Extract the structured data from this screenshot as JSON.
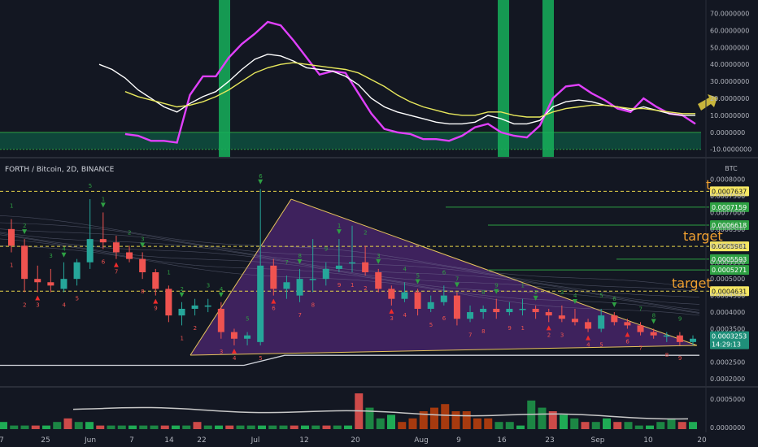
{
  "chart": {
    "title": "FORTH / Bitcoin, 2D, BINANCE",
    "unit": "BTC",
    "countdown": "14:29:13",
    "target_label": "target",
    "partial_target_label": "t"
  },
  "colors": {
    "background": "#131722",
    "bull": "#26a69a",
    "bear": "#ef5350",
    "triangle_fill": "#5b2a86",
    "triangle_line": "#e6c35c",
    "oscillator_fast": "#e040fb",
    "oscillator_mid": "#ffffff",
    "oscillator_slow": "#e8e85c",
    "oscillator_band": "#0b6e4f",
    "signal_bar": "#16b05a",
    "arrow": "#c8b53c",
    "dashed_target": "#e6d44a",
    "target_text": "#f0a030",
    "level_line": "#2ea043"
  },
  "chart_data": [
    {
      "type": "line",
      "name": "oscillator",
      "y_ticks": [
        "70.0000000",
        "60.0000000",
        "50.0000000",
        "40.0000000",
        "30.0000000",
        "20.0000000",
        "10.0000000",
        "0.0000000",
        "-10.0000000"
      ],
      "ylim": [
        -13,
        76
      ],
      "band": [
        -10,
        0
      ],
      "series": [
        {
          "role": "fast",
          "values": [
            5,
            -1,
            -1,
            -2,
            -5,
            -5,
            -6,
            22,
            33,
            33,
            44,
            52,
            58,
            65,
            63,
            54,
            44,
            34,
            36,
            35,
            23,
            11,
            2,
            0,
            -1,
            -4,
            -4,
            -5,
            -2,
            3,
            5,
            0,
            -2,
            -3,
            4,
            20,
            27,
            28,
            23,
            19,
            14,
            12,
            20,
            15,
            11,
            10,
            5
          ]
        },
        {
          "role": "mid",
          "values": [
            40,
            37,
            32,
            25,
            20,
            15,
            12,
            17,
            21,
            24,
            30,
            37,
            43,
            46,
            45,
            42,
            38,
            37,
            36,
            33,
            28,
            20,
            15,
            12,
            10,
            8,
            6,
            5,
            5,
            6,
            10,
            8,
            5,
            5,
            7,
            15,
            18,
            19,
            18,
            16,
            15,
            13,
            15,
            13,
            11,
            10,
            10
          ]
        },
        {
          "role": "slow",
          "values": [
            30,
            27,
            24,
            21,
            19,
            17,
            15,
            16,
            18,
            21,
            25,
            30,
            35,
            38,
            40,
            41,
            40,
            39,
            38,
            37,
            35,
            31,
            27,
            22,
            18,
            15,
            13,
            11,
            10,
            10,
            12,
            12,
            10,
            9,
            9,
            12,
            14,
            15,
            16,
            16,
            15,
            14,
            14,
            13,
            12,
            11,
            11
          ]
        }
      ],
      "signal_bars": [
        "Jun 24",
        "Aug 14",
        "Aug 23"
      ],
      "annotation": "arrow"
    },
    {
      "type": "bar",
      "name": "FORTH / Bitcoin, 2D, BINANCE",
      "candles": [
        {
          "o": 0.00065,
          "h": 0.00068,
          "l": 0.00058,
          "c": 0.0006
        },
        {
          "o": 0.0006,
          "h": 0.00062,
          "l": 0.00046,
          "c": 0.0005
        },
        {
          "o": 0.0005,
          "h": 0.00054,
          "l": 0.00046,
          "c": 0.00049
        },
        {
          "o": 0.00049,
          "h": 0.00053,
          "l": 0.00046,
          "c": 0.00048
        },
        {
          "o": 0.00047,
          "h": 0.00055,
          "l": 0.00046,
          "c": 0.0005
        },
        {
          "o": 0.0005,
          "h": 0.00056,
          "l": 0.00048,
          "c": 0.00055
        },
        {
          "o": 0.00055,
          "h": 0.00074,
          "l": 0.00053,
          "c": 0.00062
        },
        {
          "o": 0.00062,
          "h": 0.0007,
          "l": 0.00059,
          "c": 0.00061
        },
        {
          "o": 0.00061,
          "h": 0.00063,
          "l": 0.00056,
          "c": 0.00058
        },
        {
          "o": 0.00058,
          "h": 0.0006,
          "l": 0.00055,
          "c": 0.00056
        },
        {
          "o": 0.00056,
          "h": 0.00058,
          "l": 0.0005,
          "c": 0.00052
        },
        {
          "o": 0.00052,
          "h": 0.00053,
          "l": 0.00045,
          "c": 0.00047
        },
        {
          "o": 0.00047,
          "h": 0.00048,
          "l": 0.00037,
          "c": 0.00039
        },
        {
          "o": 0.00039,
          "h": 0.00043,
          "l": 0.00036,
          "c": 0.00041
        },
        {
          "o": 0.00041,
          "h": 0.00044,
          "l": 0.00039,
          "c": 0.00042
        },
        {
          "o": 0.00042,
          "h": 0.00044,
          "l": 0.0004,
          "c": 0.00042
        },
        {
          "o": 0.00041,
          "h": 0.00043,
          "l": 0.00032,
          "c": 0.00034
        },
        {
          "o": 0.00034,
          "h": 0.00035,
          "l": 0.0003,
          "c": 0.00032
        },
        {
          "o": 0.00032,
          "h": 0.00034,
          "l": 0.0003,
          "c": 0.00033
        },
        {
          "o": 0.00031,
          "h": 0.00077,
          "l": 0.0003,
          "c": 0.00054
        },
        {
          "o": 0.00054,
          "h": 0.00056,
          "l": 0.00045,
          "c": 0.00047
        },
        {
          "o": 0.00047,
          "h": 0.00051,
          "l": 0.00044,
          "c": 0.00049
        },
        {
          "o": 0.00045,
          "h": 0.00053,
          "l": 0.00043,
          "c": 0.0005
        },
        {
          "o": 0.0005,
          "h": 0.00062,
          "l": 0.00046,
          "c": 0.0005
        },
        {
          "o": 0.0005,
          "h": 0.00055,
          "l": 0.00048,
          "c": 0.00053
        },
        {
          "o": 0.00053,
          "h": 0.00062,
          "l": 0.00052,
          "c": 0.00054
        },
        {
          "o": 0.00055,
          "h": 0.00066,
          "l": 0.00052,
          "c": 0.00055
        },
        {
          "o": 0.00055,
          "h": 0.0006,
          "l": 0.00051,
          "c": 0.00052
        },
        {
          "o": 0.00052,
          "h": 0.00053,
          "l": 0.00046,
          "c": 0.00047
        },
        {
          "o": 0.00047,
          "h": 0.00048,
          "l": 0.00042,
          "c": 0.00044
        },
        {
          "o": 0.00044,
          "h": 0.00049,
          "l": 0.00043,
          "c": 0.00046
        },
        {
          "o": 0.00046,
          "h": 0.00047,
          "l": 0.00039,
          "c": 0.00041
        },
        {
          "o": 0.00041,
          "h": 0.00045,
          "l": 0.0004,
          "c": 0.00043
        },
        {
          "o": 0.00043,
          "h": 0.00048,
          "l": 0.00042,
          "c": 0.00045
        },
        {
          "o": 0.00045,
          "h": 0.00046,
          "l": 0.00036,
          "c": 0.00038
        },
        {
          "o": 0.00038,
          "h": 0.00042,
          "l": 0.00037,
          "c": 0.0004
        },
        {
          "o": 0.0004,
          "h": 0.00042,
          "l": 0.00038,
          "c": 0.00041
        },
        {
          "o": 0.00041,
          "h": 0.00044,
          "l": 0.00038,
          "c": 0.0004
        },
        {
          "o": 0.0004,
          "h": 0.00043,
          "l": 0.00039,
          "c": 0.00041
        },
        {
          "o": 0.00041,
          "h": 0.00044,
          "l": 0.00039,
          "c": 0.00041
        },
        {
          "o": 0.00041,
          "h": 0.00042,
          "l": 0.00038,
          "c": 0.0004
        },
        {
          "o": 0.0004,
          "h": 0.00041,
          "l": 0.00037,
          "c": 0.00039
        },
        {
          "o": 0.00039,
          "h": 0.00042,
          "l": 0.00037,
          "c": 0.00038
        },
        {
          "o": 0.00038,
          "h": 0.00041,
          "l": 0.00036,
          "c": 0.00037
        },
        {
          "o": 0.00037,
          "h": 0.00038,
          "l": 0.00034,
          "c": 0.00035
        },
        {
          "o": 0.00035,
          "h": 0.00041,
          "l": 0.00034,
          "c": 0.00039
        },
        {
          "o": 0.00039,
          "h": 0.0004,
          "l": 0.00036,
          "c": 0.00037
        },
        {
          "o": 0.00037,
          "h": 0.00038,
          "l": 0.00035,
          "c": 0.00036
        },
        {
          "o": 0.00036,
          "h": 0.00037,
          "l": 0.00033,
          "c": 0.00034
        },
        {
          "o": 0.00034,
          "h": 0.00035,
          "l": 0.00032,
          "c": 0.00033
        },
        {
          "o": 0.00033,
          "h": 0.00034,
          "l": 0.00031,
          "c": 0.00033
        },
        {
          "o": 0.00033,
          "h": 0.00034,
          "l": 0.0003,
          "c": 0.00031
        },
        {
          "o": 0.00031,
          "h": 0.00033,
          "l": 0.0003,
          "c": 0.00032
        }
      ],
      "y_ticks": [
        "0.0008500",
        "0.0008000",
        "0.0007500",
        "0.0007000",
        "0.0006500",
        "0.0006000",
        "0.0005500",
        "0.0005000",
        "0.0004500",
        "0.0004000",
        "0.0003500",
        "0.0003000",
        "0.0002500",
        "0.0002000"
      ],
      "ylim": [
        0.00018,
        0.00086
      ],
      "price_tags": [
        {
          "label": "0.0007637",
          "value": 0.0007637,
          "style": "dashed"
        },
        {
          "label": "0.0007159",
          "value": 0.0007159,
          "style": "line"
        },
        {
          "label": "0.0006618",
          "value": 0.0006618,
          "style": "line"
        },
        {
          "label": "0.0005981",
          "value": 0.0005981,
          "style": "dashed"
        },
        {
          "label": "0.0005593",
          "value": 0.0005593,
          "style": "line"
        },
        {
          "label": "0.0005271",
          "value": 0.0005271,
          "style": "line"
        },
        {
          "label": "0.0004631",
          "value": 0.0004631,
          "style": "dashed"
        }
      ],
      "last_price": "0.0003253",
      "triangle": {
        "apex": 0.00074,
        "base": 0.00029
      },
      "support_line": [
        0.00024,
        0.00024,
        0.00024,
        0.00027,
        0.00027,
        0.00027,
        0.00027
      ],
      "up_count_labels": [
        "1",
        "2",
        "3",
        "4",
        "5",
        "1",
        "2",
        "3",
        "1",
        "2",
        "3",
        "4",
        "5",
        "6",
        "7",
        "8",
        "9",
        "1",
        "2",
        "3",
        "4",
        "5",
        "6",
        "7",
        "8",
        "9",
        "1",
        "2",
        "3",
        "4",
        "5",
        "6",
        "7",
        "8",
        "9"
      ],
      "down_count_labels": [
        "1",
        "2",
        "3",
        "4",
        "5",
        "6",
        "7",
        "8",
        "9",
        "1",
        "2",
        "3",
        "4",
        "5",
        "6",
        "7",
        "8",
        "9",
        "1",
        "2",
        "3",
        "4",
        "5",
        "6",
        "7",
        "8",
        "9",
        "1",
        "2",
        "3",
        "4",
        "5",
        "6",
        "7",
        "8",
        "9"
      ]
    },
    {
      "type": "bar",
      "name": "volume",
      "y_ticks": [
        "0.0005000",
        "0.0000000"
      ],
      "values": [
        0.2,
        0.1,
        0.1,
        0.1,
        0.1,
        0.2,
        0.3,
        0.2,
        0.2,
        0.1,
        0.1,
        0.1,
        0.1,
        0.1,
        0.1,
        0.1,
        0.1,
        0.1,
        0.2,
        0.1,
        0.1,
        0.1,
        0.1,
        0.1,
        0.1,
        0.1,
        0.1,
        0.1,
        0.1,
        0.1,
        0.1,
        0.1,
        0.1,
        1.0,
        0.6,
        0.3,
        0.4,
        0.2,
        0.3,
        0.5,
        0.6,
        0.7,
        0.5,
        0.5,
        0.3,
        0.3,
        0.2,
        0.2,
        0.1,
        0.8,
        0.6,
        0.5,
        0.4,
        0.3,
        0.2,
        0.2,
        0.3,
        0.2,
        0.2,
        0.1,
        0.1,
        0.2,
        0.3,
        0.2,
        0.2
      ]
    }
  ],
  "x_axis": {
    "labels": [
      "7",
      "25",
      "Jun",
      "7",
      "14",
      "22",
      "Jul",
      "12",
      "20",
      "Aug",
      "9",
      "16",
      "23",
      "Sep",
      "10",
      "20"
    ],
    "date_labels": [
      "25",
      "Jun",
      "7",
      "14",
      "22",
      "Jul",
      "12",
      "20",
      "Aug",
      "9",
      "16",
      "23",
      "Sep",
      "10",
      "20"
    ]
  }
}
